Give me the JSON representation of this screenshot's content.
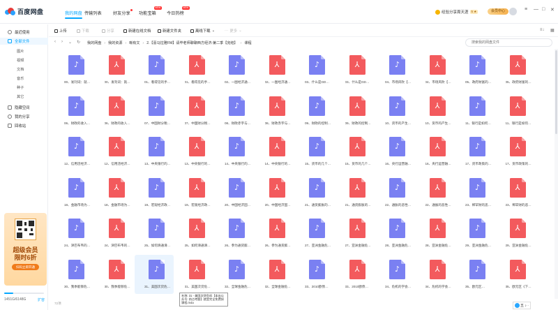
{
  "app": {
    "logo": "百度网盘"
  },
  "nav": {
    "tabs": [
      {
        "label": "我的网盘",
        "active": true
      },
      {
        "label": "传输列表"
      },
      {
        "label": "好友分享",
        "dot": true
      },
      {
        "label": "功能宝箱",
        "tag": "NEW"
      },
      {
        "label": "今日热榜",
        "tag": "NEW"
      }
    ]
  },
  "topbar": {
    "checkin": "经验分享周天涯",
    "level": "5 ★",
    "member": "会员中心",
    "window": [
      "≡",
      "—",
      "□",
      "✕"
    ]
  },
  "sidebar": {
    "items": [
      {
        "label": "最近使用",
        "icon": "clock-icon"
      },
      {
        "label": "全部文件",
        "icon": "folder-icon",
        "active": true
      },
      {
        "label": "隐藏空间",
        "icon": "lock-icon"
      },
      {
        "label": "我的分享",
        "icon": "share-icon"
      },
      {
        "label": "回收站",
        "icon": "trash-icon"
      }
    ],
    "sub": [
      "图片",
      "视频",
      "文档",
      "音乐",
      "种子",
      "其它"
    ]
  },
  "promo": {
    "line1": "超级会员",
    "line2": "限时6折",
    "button": "扫码立即开通"
  },
  "storage": {
    "used": "1451G/6148G",
    "expand": "扩容",
    "fraction": 0.236
  },
  "toolbar": {
    "buttons": [
      {
        "label": "上传",
        "enabled": true
      },
      {
        "label": "下载",
        "enabled": false
      },
      {
        "label": "分享",
        "enabled": false
      },
      {
        "label": "新建在线文档",
        "enabled": true
      },
      {
        "label": "新建文件夹",
        "enabled": true
      },
      {
        "label": "离线下载",
        "enabled": true
      },
      {
        "label": "更多",
        "enabled": false
      }
    ],
    "right_icons": [
      "sort-icon",
      "grid-view-icon"
    ]
  },
  "breadcrumb": {
    "nav": [
      "‹",
      "›",
      "⌄",
      "↻"
    ],
    "path": [
      "我的网盘",
      "我的资源",
      "晰有文",
      "2.【喜马拉雅FM】请毕老师聊聊西方经济-第二季【完结】",
      "课程"
    ],
    "search_placeholder": "搜索我的网盘文件"
  },
  "files": [
    {
      "name": "00、发刊词：就…",
      "type": "audio"
    },
    {
      "name": "00、发刊词：就…",
      "type": "pdf"
    },
    {
      "name": "01、看得见的手…",
      "type": "audio"
    },
    {
      "name": "01、看得见的手…",
      "type": "pdf"
    },
    {
      "name": "02、一图经济通…",
      "type": "audio"
    },
    {
      "name": "02、一图经济通…",
      "type": "pdf"
    },
    {
      "name": "03、什么是GDP…",
      "type": "audio"
    },
    {
      "name": "03、什么是GDP…",
      "type": "pdf"
    },
    {
      "name": "04、市场风吹【…",
      "type": "audio"
    },
    {
      "name": "04、市场风吹【…",
      "type": "pdf"
    },
    {
      "name": "05、政府财富的…",
      "type": "audio"
    },
    {
      "name": "05、政府财富的…",
      "type": "pdf"
    },
    {
      "name": "06、财政的收入…",
      "type": "audio"
    },
    {
      "name": "06、财政的收入…",
      "type": "pdf"
    },
    {
      "name": "07、中国财分税…",
      "type": "audio"
    },
    {
      "name": "07、中国财分税…",
      "type": "pdf"
    },
    {
      "name": "08、财政赤字与…",
      "type": "audio"
    },
    {
      "name": "08、财政赤字与…",
      "type": "pdf"
    },
    {
      "name": "09、财政的控制…",
      "type": "audio"
    },
    {
      "name": "09、财政的控制…",
      "type": "pdf"
    },
    {
      "name": "10、货币的产生…",
      "type": "audio"
    },
    {
      "name": "10、货币的产生…",
      "type": "pdf"
    },
    {
      "name": "11、银行是如何…",
      "type": "audio"
    },
    {
      "name": "11、银行是如何…",
      "type": "pdf"
    },
    {
      "name": "12、信用违经济…",
      "type": "audio"
    },
    {
      "name": "12、信用违经济…",
      "type": "pdf"
    },
    {
      "name": "13、中央银行的…",
      "type": "audio"
    },
    {
      "name": "13、中央银行的…",
      "type": "pdf"
    },
    {
      "name": "14、中央银行的…",
      "type": "audio"
    },
    {
      "name": "14、中央银行的…",
      "type": "pdf"
    },
    {
      "name": "15、货币的几个…",
      "type": "audio"
    },
    {
      "name": "15、货币的几个…",
      "type": "pdf"
    },
    {
      "name": "16、央行运营融…",
      "type": "audio"
    },
    {
      "name": "16、央行运营融…",
      "type": "pdf"
    },
    {
      "name": "17、货币政策的…",
      "type": "audio"
    },
    {
      "name": "17、货币政策的…",
      "type": "pdf"
    },
    {
      "name": "18、金融市场为…",
      "type": "audio"
    },
    {
      "name": "18、金融市场为…",
      "type": "pdf"
    },
    {
      "name": "19、宏观经济政…",
      "type": "audio"
    },
    {
      "name": "19、宏观经济政…",
      "type": "pdf"
    },
    {
      "name": "20、中国经济固…",
      "type": "audio"
    },
    {
      "name": "20、中国经济固…",
      "type": "pdf"
    },
    {
      "name": "21、通货膨胀的…",
      "type": "audio"
    },
    {
      "name": "21、通货膨胀的…",
      "type": "pdf"
    },
    {
      "name": "22、通胀的恶性…",
      "type": "audio"
    },
    {
      "name": "22、通胀的恶性…",
      "type": "pdf"
    },
    {
      "name": "23、稀罕财的恶…",
      "type": "audio"
    },
    {
      "name": "23、稀罕财的恶…",
      "type": "pdf"
    },
    {
      "name": "24、津巴布韦的…",
      "type": "audio"
    },
    {
      "name": "24、津巴布韦的…",
      "type": "pdf"
    },
    {
      "name": "25、如何滑通滑…",
      "type": "audio"
    },
    {
      "name": "25、如何滑通滑…",
      "type": "pdf"
    },
    {
      "name": "26、参为通货膨…",
      "type": "audio"
    },
    {
      "name": "26、参为通货膨…",
      "type": "pdf"
    },
    {
      "name": "27、亚洲金融危…",
      "type": "audio"
    },
    {
      "name": "27、亚洲金融危…",
      "type": "pdf"
    },
    {
      "name": "28、亚洲金融危…",
      "type": "audio"
    },
    {
      "name": "28、亚洲金融危…",
      "type": "pdf"
    },
    {
      "name": "29、亚洲金融危…",
      "type": "audio"
    },
    {
      "name": "29、亚洲金融危…",
      "type": "pdf"
    },
    {
      "name": "30、我季能够危…",
      "type": "audio"
    },
    {
      "name": "30、我季能够危…",
      "type": "pdf"
    },
    {
      "name": "31、美国次贷危…",
      "type": "audio",
      "hover": true
    },
    {
      "name": "31、美国次贷危…",
      "type": "pdf"
    },
    {
      "name": "32、全球金融危…",
      "type": "audio"
    },
    {
      "name": "32、全球金融危…",
      "type": "pdf"
    },
    {
      "name": "33、2010欧债危…",
      "type": "audio"
    },
    {
      "name": "33、2010欧债危…",
      "type": "pdf"
    },
    {
      "name": "34、危机的学会…",
      "type": "audio"
    },
    {
      "name": "34、危机的学会…",
      "type": "pdf"
    },
    {
      "name": "35、欧元区…",
      "type": "audio"
    },
    {
      "name": "35、欧元区《下…",
      "type": "pdf"
    }
  ],
  "tooltip": "名称: 31 - 美国次贷危机【本出公众号: 热点考题】就是完全免费授课程.m4a",
  "status": {
    "count": "72项"
  },
  "tray": {
    "label": "五 ♪ ·"
  }
}
